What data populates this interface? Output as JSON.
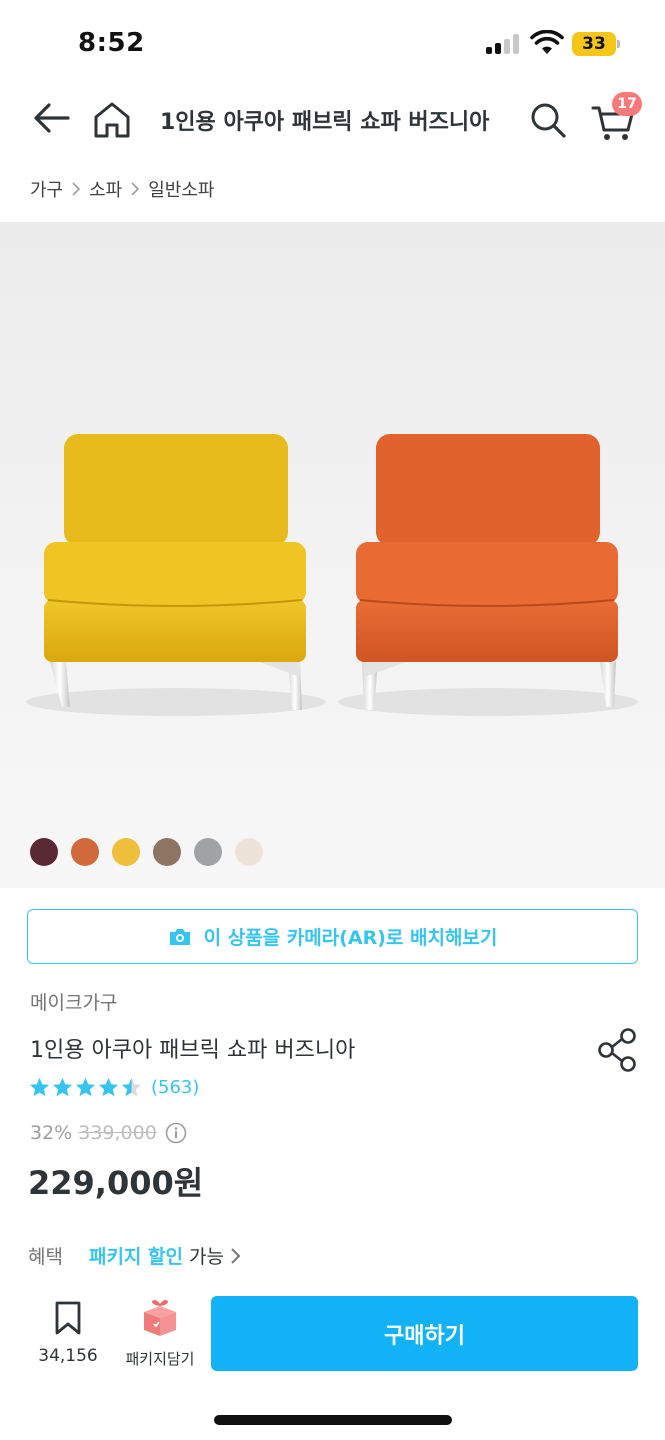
{
  "status_bar": {
    "time": "8:52",
    "battery": "33",
    "icons": [
      "signal-icon",
      "wifi-icon",
      "battery-icon"
    ]
  },
  "header": {
    "title": "1인용 아쿠아 패브릭 쇼파 버즈니아",
    "cart_count": "17",
    "icons": [
      "back-arrow-icon",
      "home-icon",
      "search-icon",
      "cart-icon"
    ]
  },
  "breadcrumb": [
    "가구",
    "소파",
    "일반소파"
  ],
  "product_image": {
    "colors": {
      "left_chair": "#e8bb1c",
      "right_chair": "#e0622d"
    }
  },
  "swatches": [
    "#5a2a34",
    "#d2693a",
    "#eebf3b",
    "#8e7563",
    "#a1a3a4",
    "#ede3d6"
  ],
  "ar_button": {
    "label": "이 상품을 카메라(AR)로 배치해보기",
    "icon": "camera-icon"
  },
  "product": {
    "brand": "메이크가구",
    "name": "1인용 아쿠아 패브릭 쇼파 버즈니아",
    "rating": 4.5,
    "review_count": "(563)",
    "discount_rate": "32%",
    "original_price": "339,000",
    "sale_price": "229,000원"
  },
  "benefit": {
    "label": "혜택",
    "link": "패키지 할인",
    "text": "가능"
  },
  "bottom_bar": {
    "bookmark_count": "34,156",
    "package_label": "패키지담기",
    "buy_label": "구매하기"
  },
  "colors": {
    "accent": "#35c5f0",
    "buy_button": "#12b3f6",
    "badge": "#f77a7a"
  }
}
